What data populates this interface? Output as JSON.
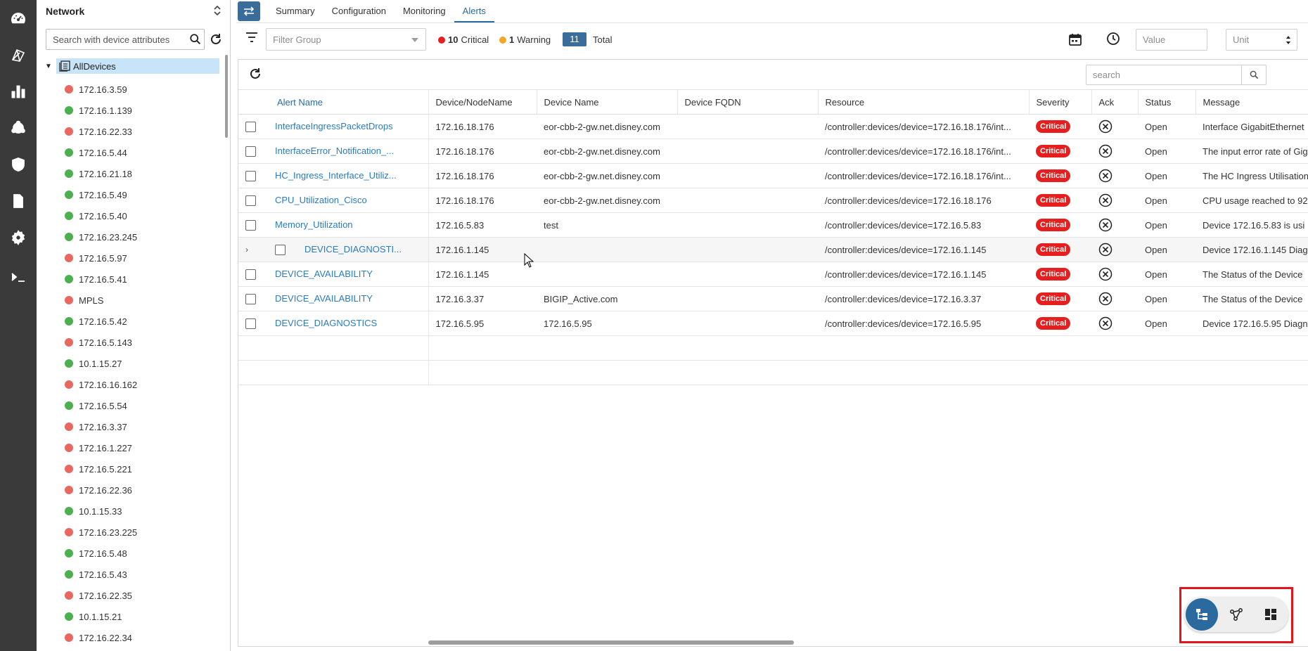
{
  "sidebar": {
    "title": "Network",
    "search_placeholder": "Search with device attributes",
    "root_label": "AllDevices",
    "devices": [
      {
        "label": "172.16.3.59",
        "status": "red"
      },
      {
        "label": "172.16.1.139",
        "status": "green"
      },
      {
        "label": "172.16.22.33",
        "status": "red"
      },
      {
        "label": "172.16.5.44",
        "status": "green"
      },
      {
        "label": "172.16.21.18",
        "status": "green"
      },
      {
        "label": "172.16.5.49",
        "status": "green"
      },
      {
        "label": "172.16.5.40",
        "status": "green"
      },
      {
        "label": "172.16.23.245",
        "status": "green"
      },
      {
        "label": "172.16.5.97",
        "status": "red"
      },
      {
        "label": "172.16.5.41",
        "status": "green"
      },
      {
        "label": "MPLS",
        "status": "red"
      },
      {
        "label": "172.16.5.42",
        "status": "green"
      },
      {
        "label": "172.16.5.143",
        "status": "red"
      },
      {
        "label": "10.1.15.27",
        "status": "green"
      },
      {
        "label": "172.16.16.162",
        "status": "red"
      },
      {
        "label": "172.16.5.54",
        "status": "green"
      },
      {
        "label": "172.16.3.37",
        "status": "red"
      },
      {
        "label": "172.16.1.227",
        "status": "red"
      },
      {
        "label": "172.16.5.221",
        "status": "red"
      },
      {
        "label": "172.16.22.36",
        "status": "red"
      },
      {
        "label": "10.1.15.33",
        "status": "green"
      },
      {
        "label": "172.16.23.225",
        "status": "red"
      },
      {
        "label": "172.16.5.48",
        "status": "green"
      },
      {
        "label": "172.16.5.43",
        "status": "green"
      },
      {
        "label": "172.16.22.35",
        "status": "red"
      },
      {
        "label": "10.1.15.21",
        "status": "green"
      },
      {
        "label": "172.16.22.34",
        "status": "red"
      }
    ]
  },
  "rail_icons": [
    "dashboard-icon",
    "topology-icon",
    "reports-chart-icon",
    "services-icon",
    "security-shield-icon",
    "document-icon",
    "settings-gear-icon",
    "terminal-icon"
  ],
  "tabs": [
    "Summary",
    "Configuration",
    "Monitoring",
    "Alerts"
  ],
  "active_tab": "Alerts",
  "filters": {
    "filter_group_placeholder": "Filter Group",
    "critical_count": "10",
    "critical_label": "Critical",
    "warning_count": "1",
    "warning_label": "Warning",
    "total_count": "11",
    "total_label": "Total",
    "value_placeholder": "Value",
    "unit_placeholder": "Unit"
  },
  "grid": {
    "search_placeholder": "search",
    "columns": [
      "Alert Name",
      "Device/NodeName",
      "Device Name",
      "Device FQDN",
      "Resource",
      "Severity",
      "Ack",
      "Status",
      "Message"
    ],
    "rows": [
      {
        "name": "InterfaceIngressPacketDrops",
        "node": "172.16.18.176",
        "device": "eor-cbb-2-gw.net.disney.com",
        "fqdn": "",
        "resource": "/controller:devices/device=172.16.18.176/int...",
        "severity": "Critical",
        "status": "Open",
        "message": "Interface GigabitEthernet",
        "expandable": false
      },
      {
        "name": "InterfaceError_Notification_...",
        "node": "172.16.18.176",
        "device": "eor-cbb-2-gw.net.disney.com",
        "fqdn": "",
        "resource": "/controller:devices/device=172.16.18.176/int...",
        "severity": "Critical",
        "status": "Open",
        "message": "The input error rate of Gig",
        "expandable": false
      },
      {
        "name": "HC_Ingress_Interface_Utiliz...",
        "node": "172.16.18.176",
        "device": "eor-cbb-2-gw.net.disney.com",
        "fqdn": "",
        "resource": "/controller:devices/device=172.16.18.176/int...",
        "severity": "Critical",
        "status": "Open",
        "message": "The HC Ingress Utilisation",
        "expandable": false
      },
      {
        "name": "CPU_Utilization_Cisco",
        "node": "172.16.18.176",
        "device": "eor-cbb-2-gw.net.disney.com",
        "fqdn": "",
        "resource": "/controller:devices/device=172.16.18.176",
        "severity": "Critical",
        "status": "Open",
        "message": "CPU usage reached to 92",
        "expandable": false
      },
      {
        "name": "Memory_Utilization",
        "node": "172.16.5.83",
        "device": "test",
        "fqdn": "",
        "resource": "/controller:devices/device=172.16.5.83",
        "severity": "Critical",
        "status": "Open",
        "message": "Device 172.16.5.83 is usi",
        "expandable": false
      },
      {
        "name": "DEVICE_DIAGNOSTI...",
        "node": "172.16.1.145",
        "device": "",
        "fqdn": "",
        "resource": "/controller:devices/device=172.16.1.145",
        "severity": "Critical",
        "status": "Open",
        "message": "Device 172.16.1.145 Diag",
        "expandable": true
      },
      {
        "name": "DEVICE_AVAILABILITY",
        "node": "172.16.1.145",
        "device": "",
        "fqdn": "",
        "resource": "/controller:devices/device=172.16.1.145",
        "severity": "Critical",
        "status": "Open",
        "message": "The Status of the Device",
        "expandable": false
      },
      {
        "name": "DEVICE_AVAILABILITY",
        "node": "172.16.3.37",
        "device": "BIGIP_Active.com",
        "fqdn": "",
        "resource": "/controller:devices/device=172.16.3.37",
        "severity": "Critical",
        "status": "Open",
        "message": "The Status of the Device",
        "expandable": false
      },
      {
        "name": "DEVICE_DIAGNOSTICS",
        "node": "172.16.5.95",
        "device": "172.16.5.95",
        "fqdn": "",
        "resource": "/controller:devices/device=172.16.5.95",
        "severity": "Critical",
        "status": "Open",
        "message": "Device 172.16.5.95 Diagn",
        "expandable": false
      }
    ]
  },
  "view_switcher": [
    "tree-view-icon",
    "graph-view-icon",
    "dashboard-view-icon"
  ],
  "colors": {
    "critical": "#e61e1e",
    "warning": "#f5a623",
    "accent": "#2a6a9e",
    "link": "#2a7bc0",
    "status_red": "#e8675e",
    "status_green": "#4caf50"
  }
}
